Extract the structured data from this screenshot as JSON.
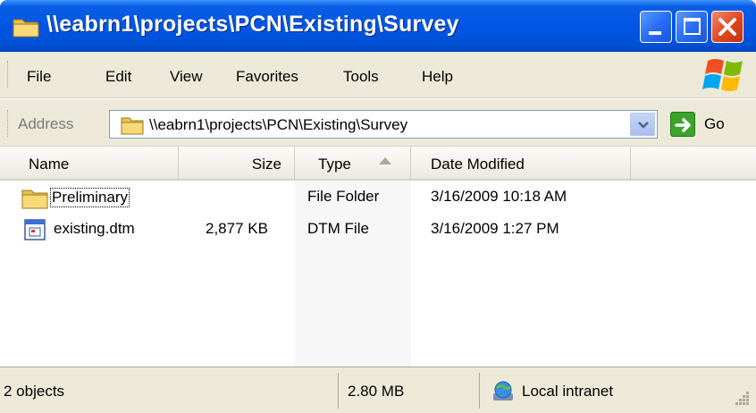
{
  "window": {
    "title": "\\\\eabrn1\\projects\\PCN\\Existing\\Survey",
    "icon": "folder-icon"
  },
  "menu": {
    "items": [
      "File",
      "Edit",
      "View",
      "Favorites",
      "Tools",
      "Help"
    ]
  },
  "address": {
    "label": "Address",
    "value": "\\\\eabrn1\\projects\\PCN\\Existing\\Survey",
    "go_label": "Go"
  },
  "columns": {
    "name": "Name",
    "size": "Size",
    "type": "Type",
    "date": "Date Modified",
    "sorted_by": "type",
    "sort_direction": "ascending"
  },
  "files": [
    {
      "name": "Preliminary",
      "size": "",
      "type": "File Folder",
      "date": "3/16/2009 10:18 AM",
      "icon": "folder-icon",
      "focused": true
    },
    {
      "name": "existing.dtm",
      "size": "2,877 KB",
      "type": "DTM File",
      "date": "3/16/2009 1:27 PM",
      "icon": "file-icon",
      "focused": false
    }
  ],
  "status": {
    "objects": "2 objects",
    "size": "2.80 MB",
    "zone": "Local intranet"
  },
  "colors": {
    "titlebar": "#0055e5",
    "chrome": "#ece9d8",
    "close_button": "#e0461e",
    "go_arrow": "#3aa52a"
  }
}
